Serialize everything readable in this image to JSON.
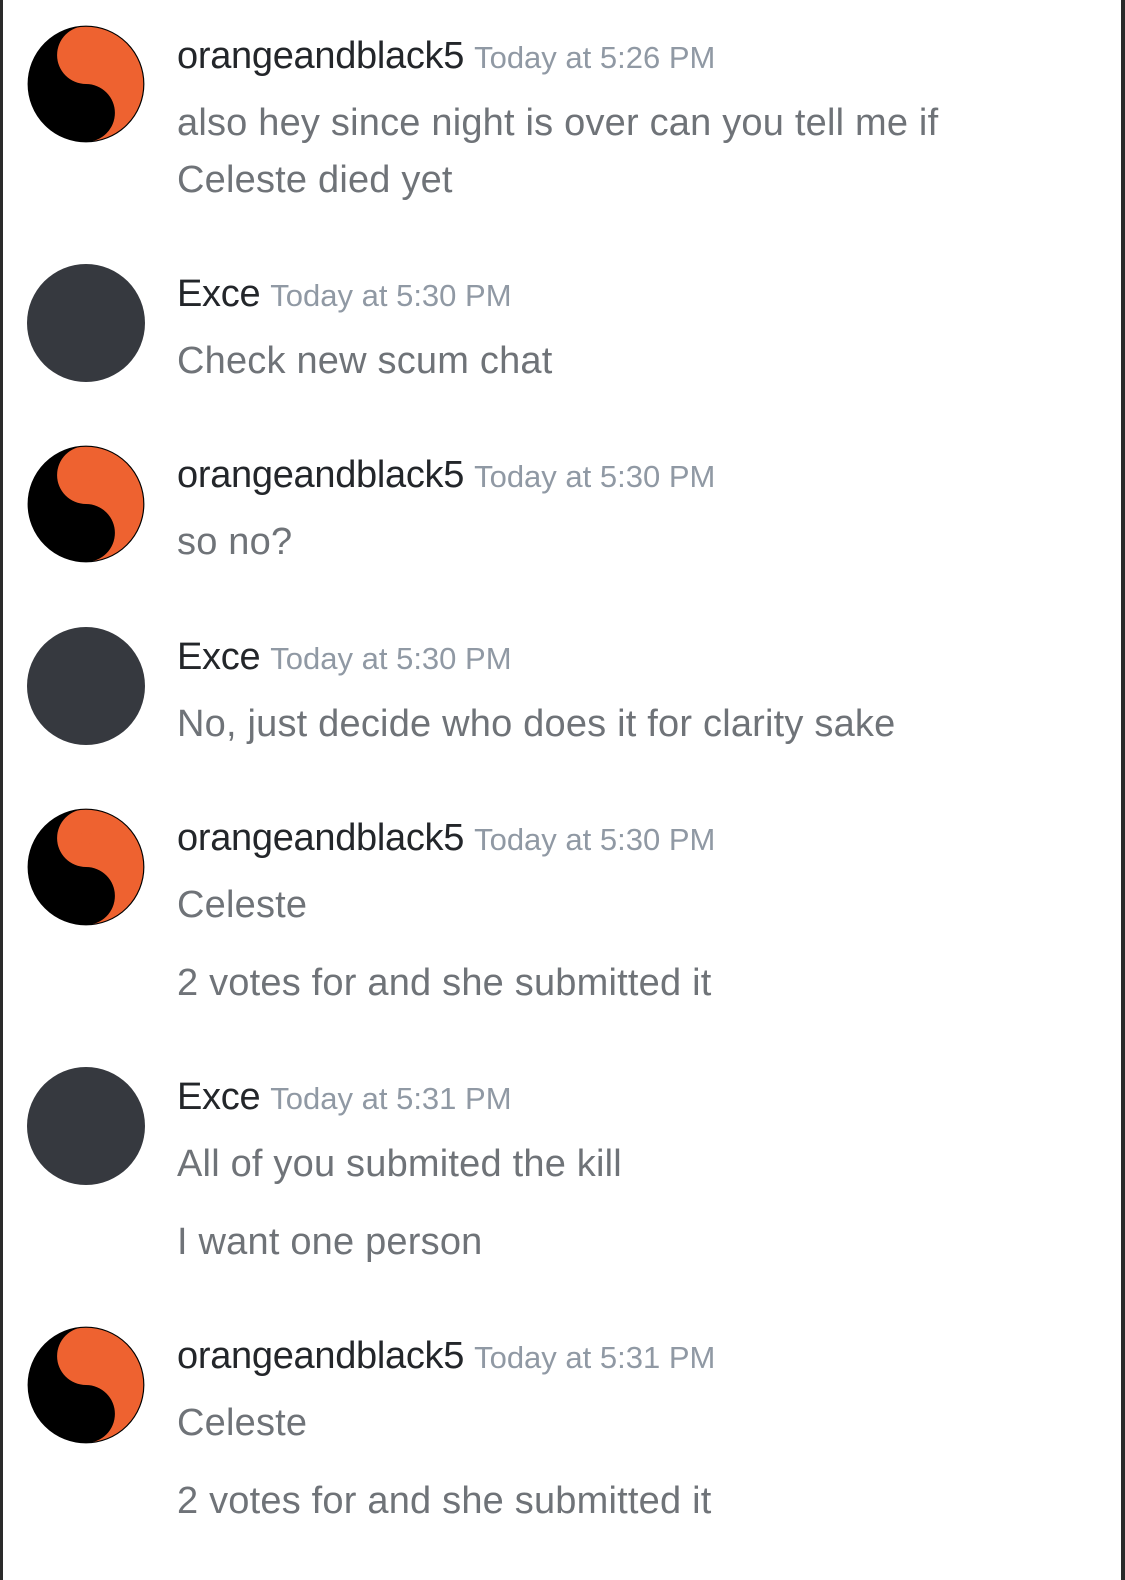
{
  "colors": {
    "username": "#23262a",
    "timestamp": "#9099a4",
    "message": "#6f7378",
    "avatar_orange": "#ee6230",
    "avatar_black": "#000000",
    "avatar_dark": "#36393f"
  },
  "messages": [
    {
      "author": "orangeandblack5",
      "avatar_icon": "yin-yang-icon",
      "timestamp": "Today at 5:26 PM",
      "lines": [
        "also hey since night is over can you tell me if",
        "Celeste died yet"
      ]
    },
    {
      "author": "Exce",
      "avatar_icon": "blank-avatar",
      "timestamp": "Today at 5:30 PM",
      "lines": [
        "Check new scum chat"
      ]
    },
    {
      "author": "orangeandblack5",
      "avatar_icon": "yin-yang-icon",
      "timestamp": "Today at 5:30 PM",
      "lines": [
        "so no?"
      ]
    },
    {
      "author": "Exce",
      "avatar_icon": "blank-avatar",
      "timestamp": "Today at 5:30 PM",
      "lines": [
        "No, just decide who does it for clarity sake"
      ]
    },
    {
      "author": "orangeandblack5",
      "avatar_icon": "yin-yang-icon",
      "timestamp": "Today at 5:30 PM",
      "lines": [
        "Celeste",
        "2 votes for and she submitted it"
      ]
    },
    {
      "author": "Exce",
      "avatar_icon": "blank-avatar",
      "timestamp": "Today at 5:31 PM",
      "lines": [
        "All of you submited the kill",
        "I want one person"
      ]
    },
    {
      "author": "orangeandblack5",
      "avatar_icon": "yin-yang-icon",
      "timestamp": "Today at 5:31 PM",
      "lines": [
        "Celeste",
        "2 votes for and she submitted it"
      ]
    }
  ]
}
